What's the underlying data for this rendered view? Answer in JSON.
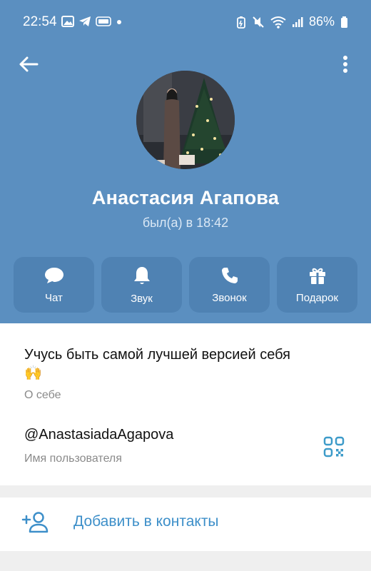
{
  "status_bar": {
    "time": "22:54",
    "battery": "86%"
  },
  "profile": {
    "name": "Анастасия Агапова",
    "last_seen": "был(а) в 18:42"
  },
  "actions": [
    {
      "label": "Чат",
      "icon": "chat-icon"
    },
    {
      "label": "Звук",
      "icon": "bell-icon"
    },
    {
      "label": "Звонок",
      "icon": "phone-icon"
    },
    {
      "label": "Подарок",
      "icon": "gift-icon"
    }
  ],
  "info": {
    "bio_line1": "Учусь быть самой лучшей версией себя",
    "bio_emoji": "🙌",
    "bio_label": "О себе",
    "username": "@AnastasiadaAgapova",
    "username_label": "Имя пользователя"
  },
  "add_contact": {
    "label": "Добавить в контакты"
  },
  "colors": {
    "header": "#5b8fc0",
    "action_button": "#4f82b3",
    "accent": "#3d8fc9"
  }
}
